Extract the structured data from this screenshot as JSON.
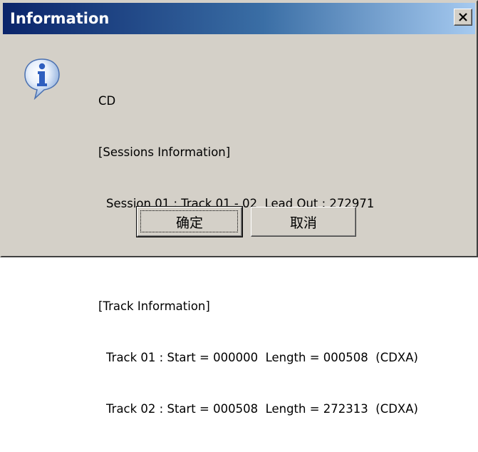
{
  "window": {
    "title": "Information",
    "close_glyph": "✕"
  },
  "icon": {
    "name": "info-icon",
    "glyph": "i",
    "color": "#3a6fc4"
  },
  "message": {
    "lines": [
      "CD",
      "[Sessions Information]",
      "Session 01 : Track 01 - 02  Lead Out : 272971",
      "",
      "[Track Information]",
      "Track 01 : Start = 000000  Length = 000508  (CDXA)",
      "Track 02 : Start = 000508  Length = 272313  (CDXA)"
    ]
  },
  "buttons": {
    "ok_label": "确定",
    "cancel_label": "取消"
  },
  "colors": {
    "face": "#d4d0c8",
    "title_start": "#0a246a",
    "title_end": "#a6caf0"
  }
}
